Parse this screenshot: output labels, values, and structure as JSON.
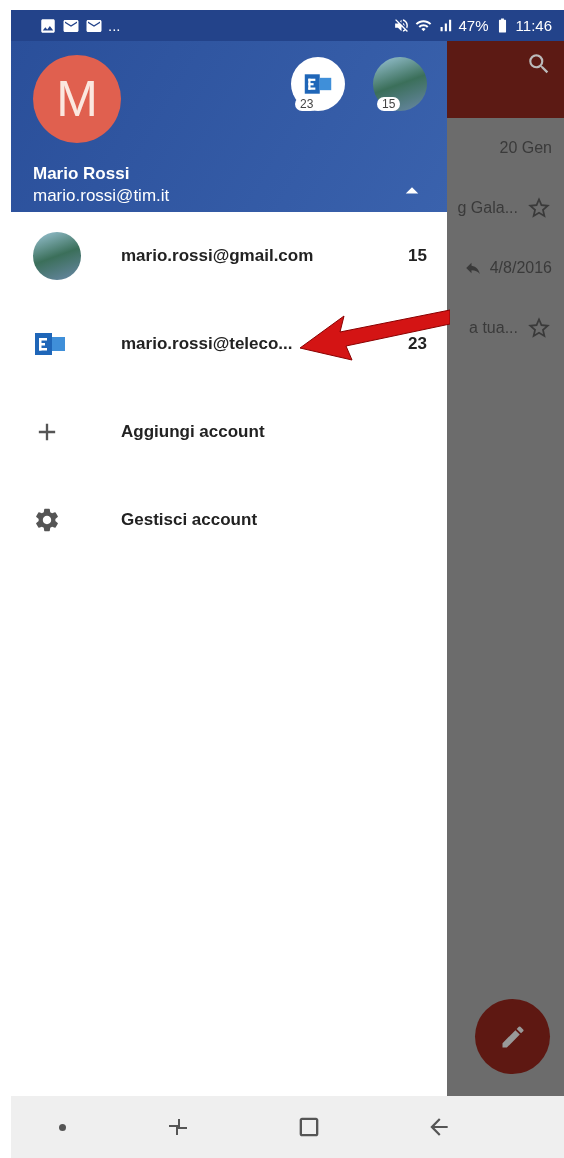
{
  "status_bar": {
    "overflow": "...",
    "battery": "47%",
    "time": "11:46"
  },
  "drawer": {
    "avatar_letter": "M",
    "other_accounts": [
      {
        "kind": "exchange",
        "count": "23"
      },
      {
        "kind": "photo",
        "count": "15"
      }
    ],
    "name": "Mario Rossi",
    "email": "mario.rossi@tim.it",
    "expanded": true,
    "accounts": [
      {
        "kind": "photo",
        "email": "mario.rossi@gmail.com",
        "count": "15"
      },
      {
        "kind": "exchange",
        "email": "mario.rossi@teleco...",
        "count": "23"
      }
    ],
    "actions": [
      {
        "kind": "add",
        "label": "Aggiungi account"
      },
      {
        "kind": "settings",
        "label": "Gestisci account"
      }
    ]
  },
  "background": {
    "messages": [
      {
        "kind": "date",
        "text": "20 Gen"
      },
      {
        "kind": "snippet",
        "text": "g Gala..."
      },
      {
        "kind": "replied-date",
        "text": "4/8/2016"
      },
      {
        "kind": "snippet",
        "text": "a tua..."
      }
    ]
  }
}
